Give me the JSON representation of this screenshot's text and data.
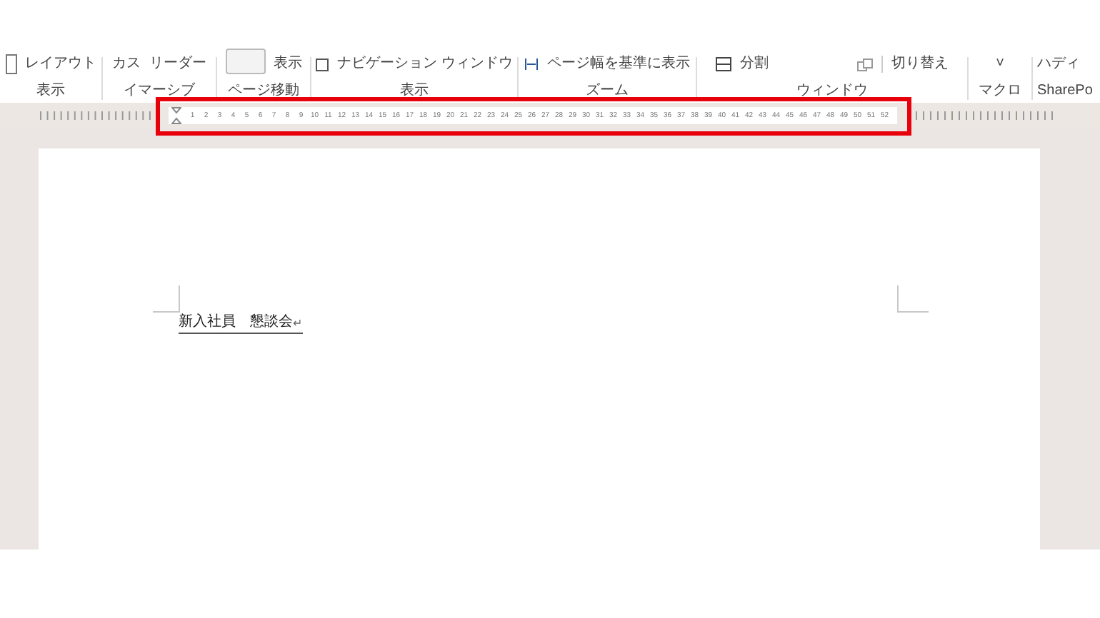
{
  "ribbon_groups": [
    {
      "items": [
        {
          "kind": "icon-label",
          "text": "レイアウト"
        }
      ],
      "label": "表示"
    },
    {
      "items": [
        {
          "kind": "text",
          "text": "カス"
        },
        {
          "kind": "text",
          "text": "リーダー"
        }
      ],
      "label": "イマーシブ"
    },
    {
      "items": [
        {
          "kind": "box"
        },
        {
          "kind": "text",
          "text": "表示"
        }
      ],
      "label": "ページ移動"
    },
    {
      "items": [
        {
          "kind": "checkbox",
          "text": "ナビゲーション ウィンドウ",
          "checked": false
        }
      ],
      "label": "表示"
    },
    {
      "items": [
        {
          "kind": "width-icon",
          "text": "ページ幅を基準に表示"
        }
      ],
      "label": "ズーム"
    },
    {
      "items": [
        {
          "kind": "split-icon",
          "text": "分割"
        },
        {
          "kind": "windows-icon"
        },
        {
          "kind": "dropdown",
          "text": "切り替え"
        }
      ],
      "label": "ウィンドウ"
    },
    {
      "items": [
        {
          "kind": "caret",
          "text": "˅"
        }
      ],
      "label": "マクロ"
    },
    {
      "items": [
        {
          "kind": "text",
          "text": "ハディ"
        }
      ],
      "label": "SharePo"
    }
  ],
  "ruler": {
    "numbers": [
      "1",
      "2",
      "3",
      "4",
      "5",
      "6",
      "7",
      "8",
      "9",
      "10",
      "11",
      "12",
      "13",
      "14",
      "15",
      "16",
      "17",
      "18",
      "19",
      "20",
      "21",
      "22",
      "23",
      "24",
      "25",
      "26",
      "27",
      "28",
      "29",
      "30",
      "31",
      "32",
      "33",
      "34",
      "35",
      "36",
      "37",
      "38",
      "39",
      "40",
      "41",
      "42",
      "43",
      "44",
      "45",
      "46",
      "47",
      "48",
      "49",
      "50",
      "51",
      "52"
    ]
  },
  "document": {
    "line": "新入社員　懇談会",
    "paragraph_mark": "↵"
  }
}
